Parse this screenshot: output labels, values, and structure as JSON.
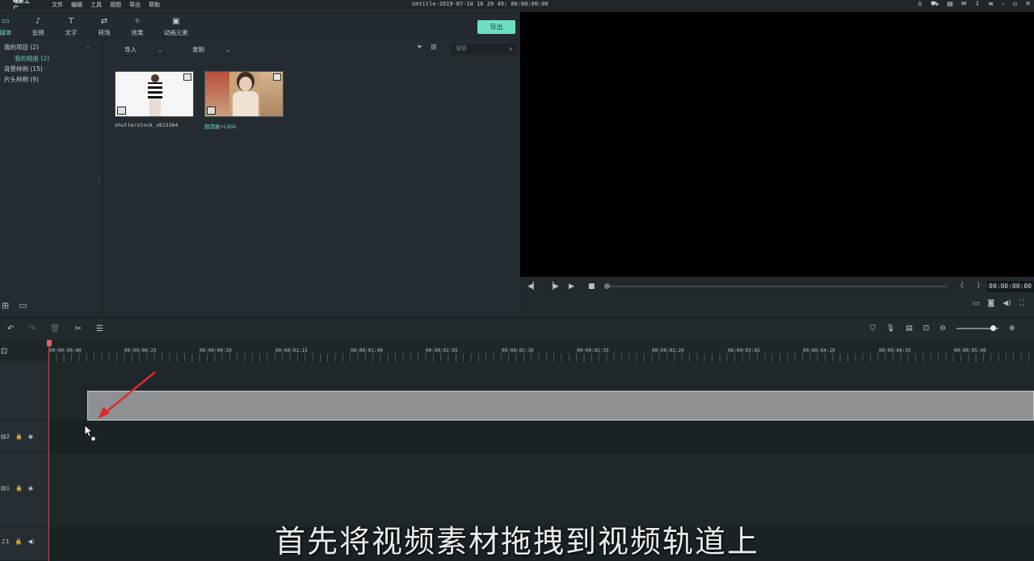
{
  "titlebar": {
    "logo": "喵影工厂",
    "menu": [
      "文件",
      "编辑",
      "工具",
      "视图",
      "导出",
      "帮助"
    ],
    "doc_title": "Untitle-2019-07-10 16 29 49: 00:00:00:00"
  },
  "toolbar": {
    "tabs": [
      {
        "label": "媒体",
        "icon": "folder-icon",
        "glyph": "▭"
      },
      {
        "label": "音频",
        "icon": "music-note-icon",
        "glyph": "♪"
      },
      {
        "label": "文字",
        "icon": "text-icon",
        "glyph": "T"
      },
      {
        "label": "转场",
        "icon": "transition-icon",
        "glyph": "⇄"
      },
      {
        "label": "效果",
        "icon": "effects-icon",
        "glyph": "✧"
      },
      {
        "label": "动画元素",
        "icon": "image-icon",
        "glyph": "▣"
      }
    ],
    "export_label": "导出"
  },
  "library": {
    "items": [
      {
        "label": "我的项目 (2)"
      },
      {
        "label": "我的相册 (2)"
      },
      {
        "label": "背景样例 (15)"
      },
      {
        "label": "片头样例 (9)"
      }
    ]
  },
  "media": {
    "import_label": "导入",
    "record_label": "录制",
    "search_placeholder": "搜索",
    "clips": [
      {
        "name": "shutterstock_v813364"
      },
      {
        "name": "丽酒屋+LOGO"
      }
    ]
  },
  "player": {
    "timecode": "00:00:00:00",
    "braces": "{ }"
  },
  "timeline": {
    "ruler_labels": [
      "00:00:00:00",
      "00:00:00:25",
      "00:00:00:50",
      "00:00:01:15",
      "00:00:01:40",
      "00:00:02:05",
      "00:00:02:30",
      "00:00:02:55",
      "00:00:03:20",
      "00:00:03:45",
      "00:00:04:10",
      "00:00:04:35",
      "00:00:05:00"
    ],
    "tracks": [
      {
        "label": "2"
      },
      {
        "label": "1"
      },
      {
        "label": "1"
      }
    ]
  },
  "subtitle": "首先将视频素材拖拽到视频轨道上"
}
